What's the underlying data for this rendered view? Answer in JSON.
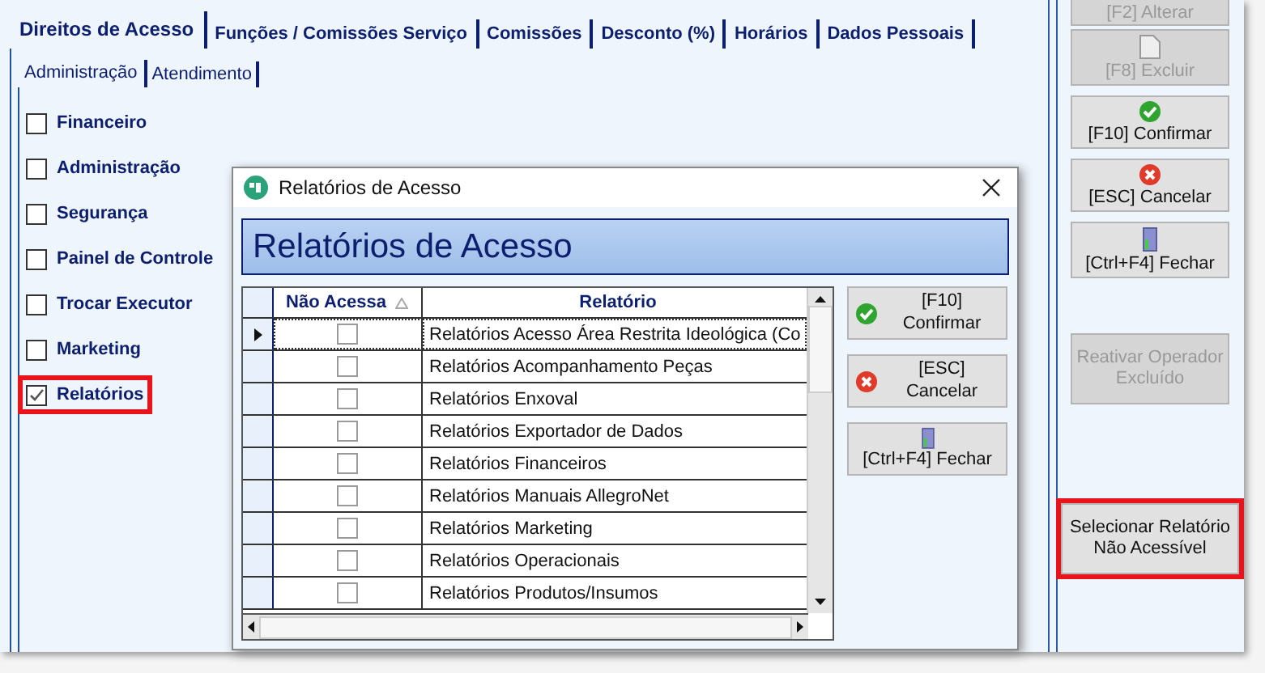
{
  "tabs": [
    {
      "label": "Direitos de Acesso",
      "selected": true
    },
    {
      "label": "Funções / Comissões Serviço",
      "selected": false
    },
    {
      "label": "Comissões",
      "selected": false
    },
    {
      "label": "Desconto (%)",
      "selected": false
    },
    {
      "label": "Horários",
      "selected": false
    },
    {
      "label": "Dados Pessoais",
      "selected": false
    }
  ],
  "subtabs": [
    {
      "label": "Administração",
      "selected": true
    },
    {
      "label": "Atendimento",
      "selected": false
    }
  ],
  "permissions": [
    {
      "label": "Financeiro",
      "checked": false,
      "highlighted": false
    },
    {
      "label": "Administração",
      "checked": false,
      "highlighted": false
    },
    {
      "label": "Segurança",
      "checked": false,
      "highlighted": false
    },
    {
      "label": "Painel de Controle",
      "checked": false,
      "highlighted": false
    },
    {
      "label": "Trocar Executor",
      "checked": false,
      "highlighted": false
    },
    {
      "label": "Marketing",
      "checked": false,
      "highlighted": false
    },
    {
      "label": "Relatórios",
      "checked": true,
      "highlighted": true
    }
  ],
  "side_buttons": [
    {
      "label": "[F2] Alterar",
      "kind": "cut",
      "disabled": true,
      "highlighted": false
    },
    {
      "label": "[F8] Excluir",
      "kind": "doc",
      "disabled": true,
      "highlighted": false
    },
    {
      "label": "[F10] Confirmar",
      "kind": "check",
      "disabled": false,
      "highlighted": false
    },
    {
      "label": "[ESC] Cancelar",
      "kind": "cross",
      "disabled": false,
      "highlighted": false
    },
    {
      "label": "[Ctrl+F4] Fechar",
      "kind": "door",
      "disabled": false,
      "highlighted": false
    },
    {
      "label": "Reativar Operador Excluído",
      "kind": "text",
      "disabled": true,
      "highlighted": false
    },
    {
      "label": "Selecionar Relatório Não Acessível",
      "kind": "text",
      "disabled": false,
      "highlighted": true
    }
  ],
  "dialog": {
    "title": "Relatórios de Acesso",
    "heading": "Relatórios de Acesso",
    "columns": [
      "Não Acessa",
      "Relatório"
    ],
    "rows": [
      {
        "name": "Relatórios Acesso Área Restrita Ideológica (Co",
        "checked": false,
        "selected": true
      },
      {
        "name": "Relatórios Acompanhamento Peças",
        "checked": false,
        "selected": false
      },
      {
        "name": "Relatórios Enxoval",
        "checked": false,
        "selected": false
      },
      {
        "name": "Relatórios Exportador de Dados",
        "checked": false,
        "selected": false
      },
      {
        "name": "Relatórios Financeiros",
        "checked": false,
        "selected": false
      },
      {
        "name": "Relatórios Manuais AllegroNet",
        "checked": false,
        "selected": false
      },
      {
        "name": "Relatórios Marketing",
        "checked": false,
        "selected": false
      },
      {
        "name": "Relatórios Operacionais",
        "checked": false,
        "selected": false
      },
      {
        "name": "Relatórios Produtos/Insumos",
        "checked": false,
        "selected": false
      }
    ],
    "buttons": [
      {
        "label": "[F10] Confirmar",
        "kind": "check"
      },
      {
        "label": "[ESC] Cancelar",
        "kind": "cross"
      },
      {
        "label": "[Ctrl+F4] Fechar",
        "kind": "door"
      }
    ]
  }
}
